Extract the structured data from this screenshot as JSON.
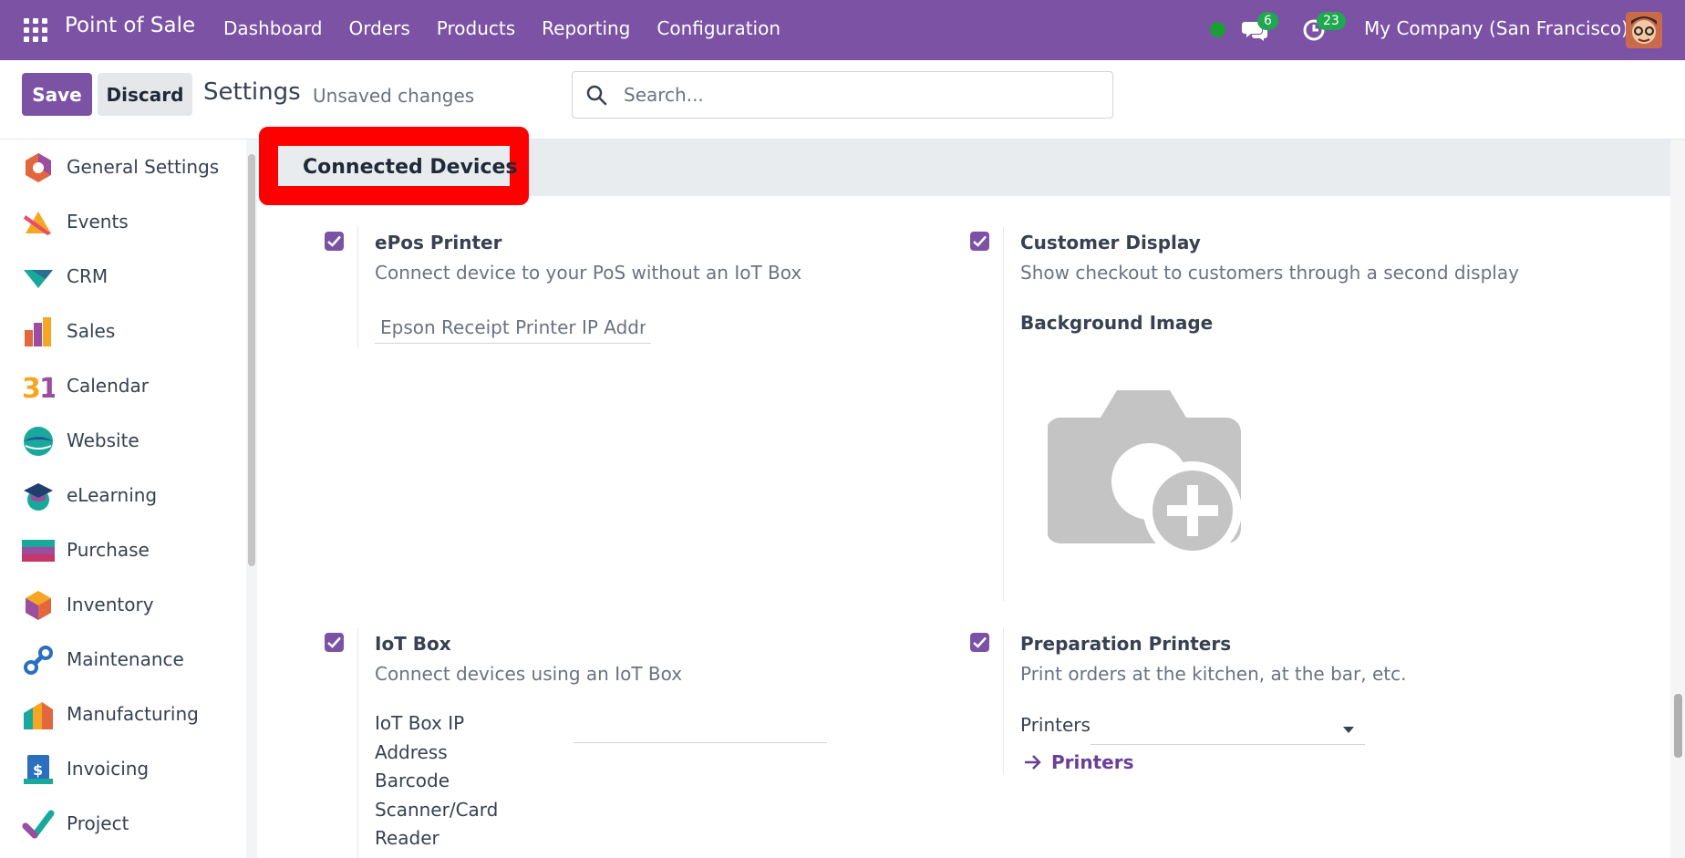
{
  "navbar": {
    "app_name": "Point of Sale",
    "menu": [
      "Dashboard",
      "Orders",
      "Products",
      "Reporting",
      "Configuration"
    ],
    "messages_count": "6",
    "activities_count": "23",
    "company": "My Company (San Francisco)",
    "color": "#7c52a5"
  },
  "control": {
    "save_label": "Save",
    "discard_label": "Discard",
    "title": "Settings",
    "status": "Unsaved changes",
    "search_placeholder": "Search..."
  },
  "sidebar": {
    "items": [
      {
        "label": "General Settings",
        "icon": "general-settings-icon"
      },
      {
        "label": "Events",
        "icon": "events-icon"
      },
      {
        "label": "CRM",
        "icon": "crm-icon"
      },
      {
        "label": "Sales",
        "icon": "sales-icon"
      },
      {
        "label": "Calendar",
        "icon": "calendar-icon"
      },
      {
        "label": "Website",
        "icon": "website-icon"
      },
      {
        "label": "eLearning",
        "icon": "elearning-icon"
      },
      {
        "label": "Purchase",
        "icon": "purchase-icon"
      },
      {
        "label": "Inventory",
        "icon": "inventory-icon"
      },
      {
        "label": "Maintenance",
        "icon": "maintenance-icon"
      },
      {
        "label": "Manufacturing",
        "icon": "manufacturing-icon"
      },
      {
        "label": "Invoicing",
        "icon": "invoicing-icon"
      },
      {
        "label": "Project",
        "icon": "project-icon"
      }
    ]
  },
  "section": {
    "title": "Connected Devices",
    "highlight_color": "#ff0000"
  },
  "settings": {
    "epos": {
      "title": "ePos Printer",
      "desc": "Connect device to your PoS without an IoT Box",
      "ip_placeholder": "Epson Receipt Printer IP Address",
      "checked": true
    },
    "customer_display": {
      "title": "Customer Display",
      "desc": "Show checkout to customers through a second display",
      "bg_label": "Background Image",
      "checked": true
    },
    "iot": {
      "title": "IoT Box",
      "desc": "Connect devices using an IoT Box",
      "ip_label_1": "IoT Box IP",
      "ip_label_2": "Address",
      "barcode_1": "Barcode",
      "barcode_2": "Scanner/Card",
      "barcode_3": "Reader",
      "checked": true
    },
    "prep": {
      "title": "Preparation Printers",
      "desc": "Print orders at the kitchen, at the bar, etc.",
      "printers_label": "Printers",
      "printers_link": "Printers",
      "checked": true
    }
  }
}
